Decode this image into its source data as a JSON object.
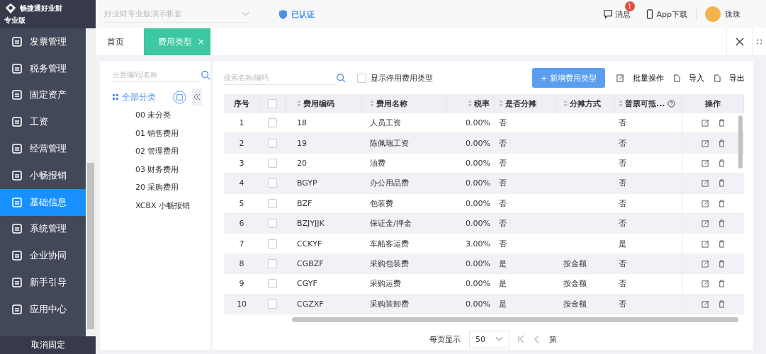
{
  "brand": {
    "name": "畅捷通好业财",
    "edition": "专业版"
  },
  "account": {
    "value": "好业财专业版演示帐套"
  },
  "verified": "已认证",
  "header": {
    "messages": "消息",
    "message_badge": "1",
    "app_download": "App下载",
    "user": "珠珠"
  },
  "sidebar": {
    "items": [
      {
        "label": "发票管理",
        "selected": false
      },
      {
        "label": "税务管理",
        "selected": false
      },
      {
        "label": "固定资产",
        "selected": false
      },
      {
        "label": "工资",
        "selected": false
      },
      {
        "label": "经营管理",
        "selected": false
      },
      {
        "label": "小畅报销",
        "selected": false
      },
      {
        "label": "基础信息",
        "selected": true
      },
      {
        "label": "系统管理",
        "selected": false
      },
      {
        "label": "企业协同",
        "selected": false
      },
      {
        "label": "新手引导",
        "selected": false
      },
      {
        "label": "应用中心",
        "selected": false
      }
    ],
    "unpin": "取消固定"
  },
  "tabs": [
    {
      "label": "首页",
      "selected": false
    },
    {
      "label": "费用类型",
      "selected": true,
      "close": "×"
    }
  ],
  "category_panel": {
    "search": {
      "placeholder": "分类编码/名称"
    },
    "root": {
      "label": "全部分类",
      "selected": true
    },
    "items": [
      {
        "label": "00 未分类",
        "selected": false
      },
      {
        "label": "01 销售费用",
        "selected": false
      },
      {
        "label": "02 管理费用",
        "selected": false
      },
      {
        "label": "03 财务费用",
        "selected": false
      },
      {
        "label": "20 采购费用",
        "selected": false
      },
      {
        "label": "XCBX 小畅报销",
        "selected": false
      }
    ]
  },
  "toolbar": {
    "search": {
      "placeholder": "搜索名称/编码"
    },
    "show_disabled": {
      "label": "显示停用费用类型",
      "checked": false
    },
    "add": "+ 新增费用类型",
    "batch": "批量操作",
    "import": "导入",
    "export": "导出"
  },
  "table": {
    "columns": [
      {
        "label": "序号",
        "sortable": false
      },
      {
        "kind": "check",
        "checked": false
      },
      {
        "label": "费用编码",
        "sortable": true
      },
      {
        "label": "费用名称",
        "sortable": true
      },
      {
        "label": "税率",
        "sortable": true
      },
      {
        "label": "是否分摊",
        "sortable": true
      },
      {
        "label": "分摊方式",
        "sortable": true
      },
      {
        "label": "普票可抵...",
        "sortable": true,
        "help": true
      },
      {
        "label": "操作",
        "sortable": false
      }
    ],
    "rows": [
      {
        "no": "1",
        "checked": false,
        "code": "18",
        "name": "人员工资",
        "rate": "0.00%",
        "shared": "否",
        "method": "",
        "deductible": "否"
      },
      {
        "no": "2",
        "checked": false,
        "code": "19",
        "name": "陈佩瑞工资",
        "rate": "0.00%",
        "shared": "否",
        "method": "",
        "deductible": "否"
      },
      {
        "no": "3",
        "checked": false,
        "code": "20",
        "name": "油费",
        "rate": "0.00%",
        "shared": "否",
        "method": "",
        "deductible": "否"
      },
      {
        "no": "4",
        "checked": false,
        "code": "BGYP",
        "name": "办公用品费",
        "rate": "0.00%",
        "shared": "否",
        "method": "",
        "deductible": "否"
      },
      {
        "no": "5",
        "checked": false,
        "code": "BZF",
        "name": "包装费",
        "rate": "0.00%",
        "shared": "否",
        "method": "",
        "deductible": "否"
      },
      {
        "no": "6",
        "checked": false,
        "code": "BZJYJJK",
        "name": "保证金/押金",
        "rate": "0.00%",
        "shared": "否",
        "method": "",
        "deductible": "否"
      },
      {
        "no": "7",
        "checked": false,
        "code": "CCKYF",
        "name": "车船客运费",
        "rate": "3.00%",
        "shared": "否",
        "method": "",
        "deductible": "是"
      },
      {
        "no": "8",
        "checked": false,
        "code": "CGBZF",
        "name": "采购包装费",
        "rate": "0.00%",
        "shared": "是",
        "method": "按金额",
        "deductible": "否"
      },
      {
        "no": "9",
        "checked": false,
        "code": "CGYF",
        "name": "采购运费",
        "rate": "0.00%",
        "shared": "是",
        "method": "按金额",
        "deductible": "否"
      },
      {
        "no": "10",
        "checked": false,
        "code": "CGZXF",
        "name": "采购装卸费",
        "rate": "0.00%",
        "shared": "是",
        "method": "按金额",
        "deductible": "否"
      }
    ]
  },
  "pagination": {
    "per_page_label": "每页显示",
    "per_page": "50",
    "page_prefix": "第"
  }
}
